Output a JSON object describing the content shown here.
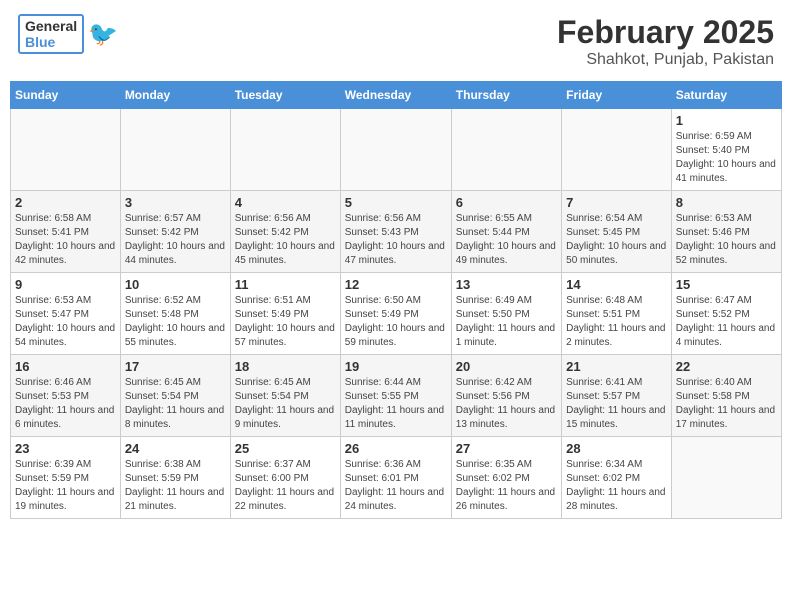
{
  "header": {
    "logo_general": "General",
    "logo_blue": "Blue",
    "month_title": "February 2025",
    "location": "Shahkot, Punjab, Pakistan"
  },
  "weekdays": [
    "Sunday",
    "Monday",
    "Tuesday",
    "Wednesday",
    "Thursday",
    "Friday",
    "Saturday"
  ],
  "weeks": [
    [
      {
        "day": "",
        "info": ""
      },
      {
        "day": "",
        "info": ""
      },
      {
        "day": "",
        "info": ""
      },
      {
        "day": "",
        "info": ""
      },
      {
        "day": "",
        "info": ""
      },
      {
        "day": "",
        "info": ""
      },
      {
        "day": "1",
        "info": "Sunrise: 6:59 AM\nSunset: 5:40 PM\nDaylight: 10 hours and 41 minutes."
      }
    ],
    [
      {
        "day": "2",
        "info": "Sunrise: 6:58 AM\nSunset: 5:41 PM\nDaylight: 10 hours and 42 minutes."
      },
      {
        "day": "3",
        "info": "Sunrise: 6:57 AM\nSunset: 5:42 PM\nDaylight: 10 hours and 44 minutes."
      },
      {
        "day": "4",
        "info": "Sunrise: 6:56 AM\nSunset: 5:42 PM\nDaylight: 10 hours and 45 minutes."
      },
      {
        "day": "5",
        "info": "Sunrise: 6:56 AM\nSunset: 5:43 PM\nDaylight: 10 hours and 47 minutes."
      },
      {
        "day": "6",
        "info": "Sunrise: 6:55 AM\nSunset: 5:44 PM\nDaylight: 10 hours and 49 minutes."
      },
      {
        "day": "7",
        "info": "Sunrise: 6:54 AM\nSunset: 5:45 PM\nDaylight: 10 hours and 50 minutes."
      },
      {
        "day": "8",
        "info": "Sunrise: 6:53 AM\nSunset: 5:46 PM\nDaylight: 10 hours and 52 minutes."
      }
    ],
    [
      {
        "day": "9",
        "info": "Sunrise: 6:53 AM\nSunset: 5:47 PM\nDaylight: 10 hours and 54 minutes."
      },
      {
        "day": "10",
        "info": "Sunrise: 6:52 AM\nSunset: 5:48 PM\nDaylight: 10 hours and 55 minutes."
      },
      {
        "day": "11",
        "info": "Sunrise: 6:51 AM\nSunset: 5:49 PM\nDaylight: 10 hours and 57 minutes."
      },
      {
        "day": "12",
        "info": "Sunrise: 6:50 AM\nSunset: 5:49 PM\nDaylight: 10 hours and 59 minutes."
      },
      {
        "day": "13",
        "info": "Sunrise: 6:49 AM\nSunset: 5:50 PM\nDaylight: 11 hours and 1 minute."
      },
      {
        "day": "14",
        "info": "Sunrise: 6:48 AM\nSunset: 5:51 PM\nDaylight: 11 hours and 2 minutes."
      },
      {
        "day": "15",
        "info": "Sunrise: 6:47 AM\nSunset: 5:52 PM\nDaylight: 11 hours and 4 minutes."
      }
    ],
    [
      {
        "day": "16",
        "info": "Sunrise: 6:46 AM\nSunset: 5:53 PM\nDaylight: 11 hours and 6 minutes."
      },
      {
        "day": "17",
        "info": "Sunrise: 6:45 AM\nSunset: 5:54 PM\nDaylight: 11 hours and 8 minutes."
      },
      {
        "day": "18",
        "info": "Sunrise: 6:45 AM\nSunset: 5:54 PM\nDaylight: 11 hours and 9 minutes."
      },
      {
        "day": "19",
        "info": "Sunrise: 6:44 AM\nSunset: 5:55 PM\nDaylight: 11 hours and 11 minutes."
      },
      {
        "day": "20",
        "info": "Sunrise: 6:42 AM\nSunset: 5:56 PM\nDaylight: 11 hours and 13 minutes."
      },
      {
        "day": "21",
        "info": "Sunrise: 6:41 AM\nSunset: 5:57 PM\nDaylight: 11 hours and 15 minutes."
      },
      {
        "day": "22",
        "info": "Sunrise: 6:40 AM\nSunset: 5:58 PM\nDaylight: 11 hours and 17 minutes."
      }
    ],
    [
      {
        "day": "23",
        "info": "Sunrise: 6:39 AM\nSunset: 5:59 PM\nDaylight: 11 hours and 19 minutes."
      },
      {
        "day": "24",
        "info": "Sunrise: 6:38 AM\nSunset: 5:59 PM\nDaylight: 11 hours and 21 minutes."
      },
      {
        "day": "25",
        "info": "Sunrise: 6:37 AM\nSunset: 6:00 PM\nDaylight: 11 hours and 22 minutes."
      },
      {
        "day": "26",
        "info": "Sunrise: 6:36 AM\nSunset: 6:01 PM\nDaylight: 11 hours and 24 minutes."
      },
      {
        "day": "27",
        "info": "Sunrise: 6:35 AM\nSunset: 6:02 PM\nDaylight: 11 hours and 26 minutes."
      },
      {
        "day": "28",
        "info": "Sunrise: 6:34 AM\nSunset: 6:02 PM\nDaylight: 11 hours and 28 minutes."
      },
      {
        "day": "",
        "info": ""
      }
    ]
  ]
}
